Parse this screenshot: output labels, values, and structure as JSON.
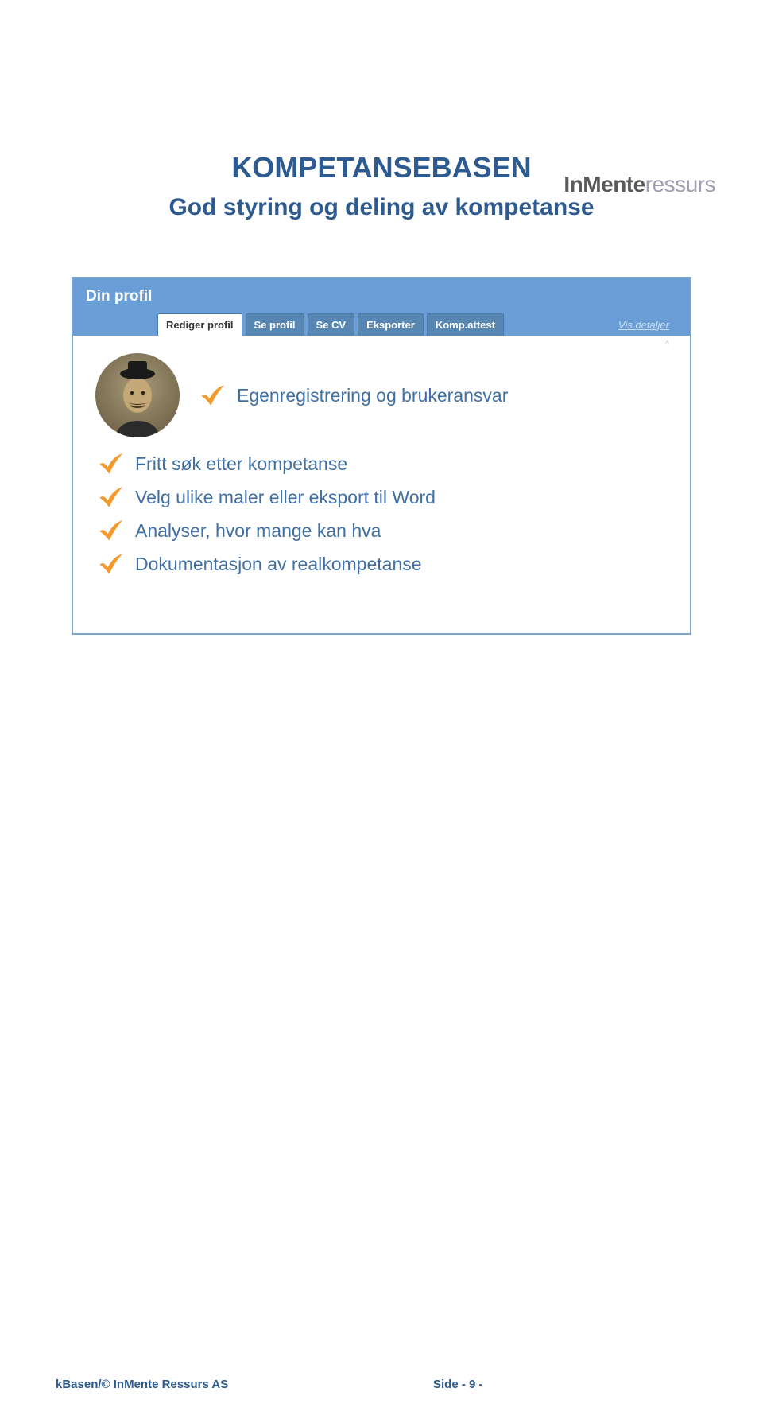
{
  "brand": {
    "in": "In",
    "mente": "Mente",
    "ressurs": "ressurs"
  },
  "headline": {
    "line1": "KOMPETANSEBASEN",
    "line2": "God styring og deling av kompetanse"
  },
  "panel": {
    "title": "Din profil",
    "tabs": [
      "Rediger profil",
      "Se profil",
      "Se CV",
      "Eksporter",
      "Komp.attest"
    ],
    "detaljer_link": "Vis detaljer",
    "bullets": [
      "Egenregistrering og brukeransvar",
      "Fritt søk etter kompetanse",
      "Velg ulike maler eller eksport til Word",
      "Analyser, hvor mange kan hva",
      "Dokumentasjon av realkompetanse"
    ]
  },
  "footer": {
    "left": "kBasen/© InMente Ressurs AS",
    "right": "Side - 9 -"
  }
}
